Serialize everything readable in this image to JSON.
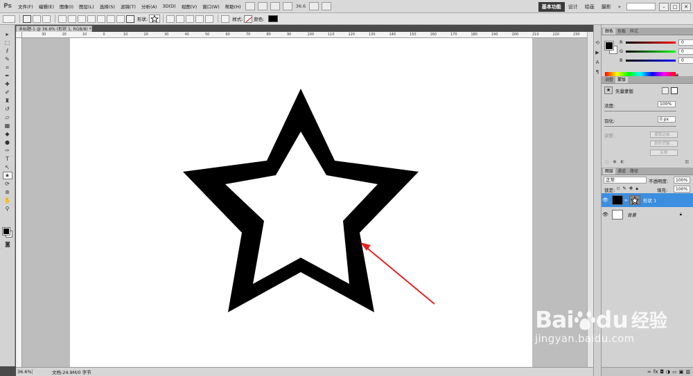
{
  "app": {
    "logo": "Ps",
    "menu": [
      "文件(F)",
      "编辑(E)",
      "图像(I)",
      "图层(L)",
      "选择(S)",
      "滤镜(T)",
      "分析(A)",
      "3D(D)",
      "视图(V)",
      "窗口(W)",
      "帮助(H)"
    ],
    "zoom": "36.6",
    "workspaces": [
      "基本功能",
      "设计",
      "绘画",
      "摄影"
    ],
    "window_buttons": [
      "–",
      "□",
      "✕"
    ]
  },
  "options_bar": {
    "shape_label": "形状:",
    "style_label": "样式:",
    "color_label": "颜色:"
  },
  "document": {
    "tab_title": "未标题-1 @ 36.6% (形状 1, RGB/8) *",
    "ruler_ticks": [
      "30",
      "20",
      "10",
      "0",
      "10",
      "20",
      "30",
      "40",
      "50",
      "60",
      "70",
      "80",
      "90",
      "100",
      "110",
      "120",
      "130",
      "140",
      "150",
      "160",
      "170",
      "180",
      "190",
      "200",
      "210",
      "220",
      "230"
    ],
    "status_zoom": "36.6%",
    "status_doc": "文档:24.9M/0 字节"
  },
  "color_panel": {
    "tabs": [
      "颜色",
      "色板",
      "样式"
    ],
    "channels": [
      {
        "label": "R",
        "value": "0",
        "color": "#e23030"
      },
      {
        "label": "G",
        "value": "0",
        "color": "#2fbf2f"
      },
      {
        "label": "B",
        "value": "0",
        "color": "#2f3fe0"
      }
    ]
  },
  "masks_panel": {
    "tabs": [
      "调整",
      "蒙版"
    ],
    "title": "矢量蒙版",
    "density_label": "浓度:",
    "density_value": "100%",
    "feather_label": "羽化:",
    "feather_value": "0 px",
    "refine_label": "调整:",
    "buttons": [
      "蒙版边缘...",
      "颜色范围...",
      "反相"
    ]
  },
  "layers_panel": {
    "tabs": [
      "图层",
      "通道",
      "路径"
    ],
    "blend_mode": "正常",
    "opacity_label": "不透明度:",
    "opacity_value": "100%",
    "lock_label": "锁定:",
    "fill_label": "填充:",
    "fill_value": "100%",
    "layers": [
      {
        "name": "形状 1",
        "selected": true
      },
      {
        "name": "背景",
        "selected": false
      }
    ]
  },
  "watermark": {
    "brand": "Bai",
    "brand2": "du",
    "brand_cn": "经验",
    "url": "jingyan.baidu.com"
  },
  "colors": {
    "arrow": "#e8201f",
    "selection": "#3b8ee0"
  }
}
